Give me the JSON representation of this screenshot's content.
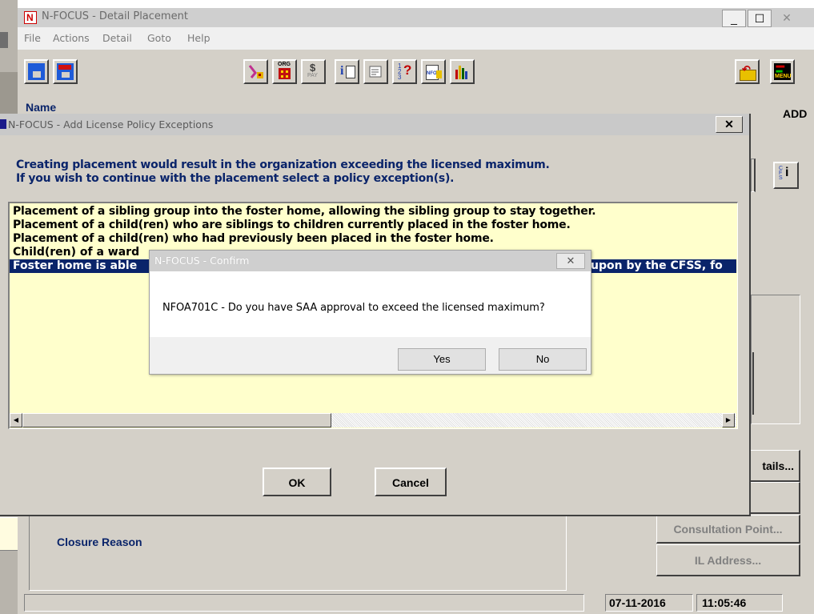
{
  "main_window": {
    "title": "N-FOCUS - Detail Placement",
    "menu": [
      "File",
      "Actions",
      "Detail",
      "Goto",
      "Help"
    ],
    "name_label": "Name",
    "add_label": "ADD",
    "closure_reason_label": "Closure Reason",
    "side_buttons": {
      "details": "tails...",
      "consultation_point": "Consultation Point...",
      "il_address": "IL Address..."
    },
    "status": {
      "date": "07-11-2016",
      "time": "11:05:46"
    },
    "toolbar_icons": [
      "save-icon",
      "exit-icon",
      "participant-icon",
      "organization-icon",
      "pay-icon",
      "info-icon",
      "notepad-icon",
      "help-icon",
      "nfo-icon",
      "chart-icon",
      "return-icon",
      "menu-icon"
    ],
    "toolbar_labels": {
      "org": "ORG",
      "pay": "PAY",
      "menu": "MENU",
      "nfo": "NFO"
    }
  },
  "license_dialog": {
    "title": "N-FOCUS - Add License Policy Exceptions",
    "message_line1": "Creating placement would result in the organization exceeding the licensed maximum.",
    "message_line2": "If you wish to continue with the placement select a policy exception(s).",
    "options": [
      "Placement of a sibling group into the foster home, allowing the sibling group to stay together.",
      "Placement of a child(ren) who are siblings to children currently placed in the foster home.",
      "Placement of a child(ren) who had previously been placed in the foster home.",
      "Child(ren) of a ward",
      "Foster home is able"
    ],
    "selected_row_tail": "upon by the CFSS, fo",
    "ok_label": "OK",
    "cancel_label": "Cancel"
  },
  "confirm_dialog": {
    "title": "N-FOCUS - Confirm",
    "message": "NFOA701C - Do you have SAA approval to exceed the licensed maximum?",
    "yes_label": "Yes",
    "no_label": "No"
  },
  "colors": {
    "window_face": "#d4d0c8",
    "title_active": "#0a246a",
    "list_background": "#ffffcc",
    "selected_row": "#0a246a",
    "label_text": "#0a246a"
  }
}
